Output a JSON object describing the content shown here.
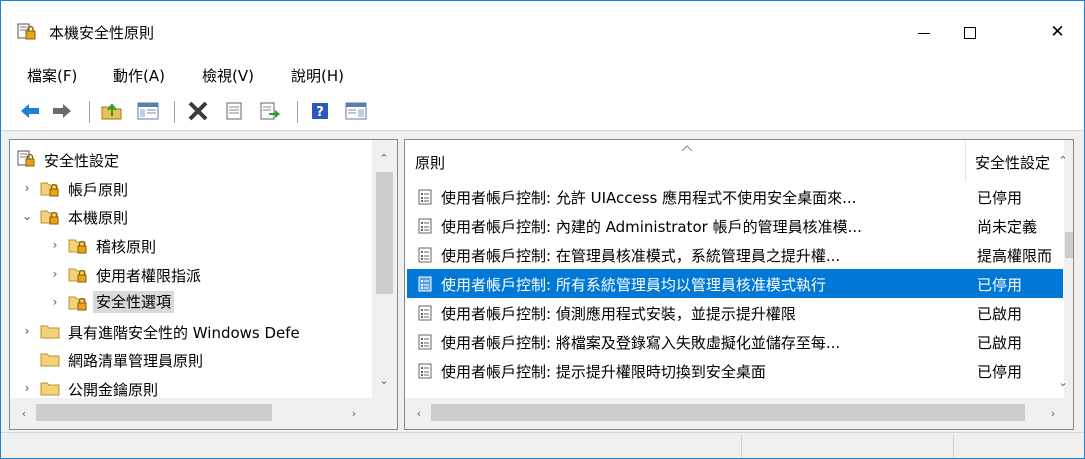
{
  "window": {
    "title": "本機安全性原則",
    "accent": "#0078d7"
  },
  "controls": {
    "minimize_icon": "minimize-icon",
    "maximize_icon": "maximize-icon",
    "close_label": "✕"
  },
  "menu": {
    "items": [
      "檔案(F)",
      "動作(A)",
      "檢視(V)",
      "說明(H)"
    ]
  },
  "toolbar": {
    "icons": [
      "back-arrow-icon",
      "forward-arrow-icon",
      "up-folder-icon",
      "show-hide-tree-icon",
      "delete-icon",
      "properties-icon",
      "export-list-icon",
      "help-icon",
      "action-pane-icon"
    ]
  },
  "tree": {
    "items": [
      {
        "label": "安全性設定",
        "expander": "",
        "icon": "security-settings-icon"
      },
      {
        "label": "帳戶原則",
        "expander": "›",
        "icon": "folder-lock-icon"
      },
      {
        "label": "本機原則",
        "expander": "⌄",
        "icon": "folder-lock-icon"
      },
      {
        "label": "稽核原則",
        "expander": "›",
        "icon": "folder-lock-icon"
      },
      {
        "label": "使用者權限指派",
        "expander": "›",
        "icon": "folder-lock-icon"
      },
      {
        "label": "安全性選項",
        "expander": "›",
        "icon": "folder-lock-icon",
        "selected": true
      },
      {
        "label": "具有進階安全性的 Windows Defe",
        "expander": "›",
        "icon": "folder-icon"
      },
      {
        "label": "網路清單管理員原則",
        "expander": "",
        "icon": "folder-icon"
      },
      {
        "label": "公開金鑰原則",
        "expander": "›",
        "icon": "folder-icon"
      }
    ]
  },
  "list": {
    "columns": [
      "原則",
      "安全性設定"
    ],
    "rows": [
      {
        "policy": "使用者帳戶控制: 允許 UIAccess 應用程式不使用安全桌面來...",
        "setting": "已停用"
      },
      {
        "policy": "使用者帳戶控制: 內建的 Administrator 帳戶的管理員核准模...",
        "setting": "尚未定義"
      },
      {
        "policy": "使用者帳戶控制: 在管理員核准模式，系統管理員之提升權...",
        "setting": "提高權限而"
      },
      {
        "policy": "使用者帳戶控制: 所有系統管理員均以管理員核准模式執行",
        "setting": "已停用",
        "selected": true
      },
      {
        "policy": "使用者帳戶控制: 偵測應用程式安裝，並提示提升權限",
        "setting": "已啟用"
      },
      {
        "policy": "使用者帳戶控制: 將檔案及登錄寫入失敗虛擬化並儲存至每...",
        "setting": "已啟用"
      },
      {
        "policy": "使用者帳戶控制: 提示提升權限時切換到安全桌面",
        "setting": "已停用"
      }
    ]
  }
}
